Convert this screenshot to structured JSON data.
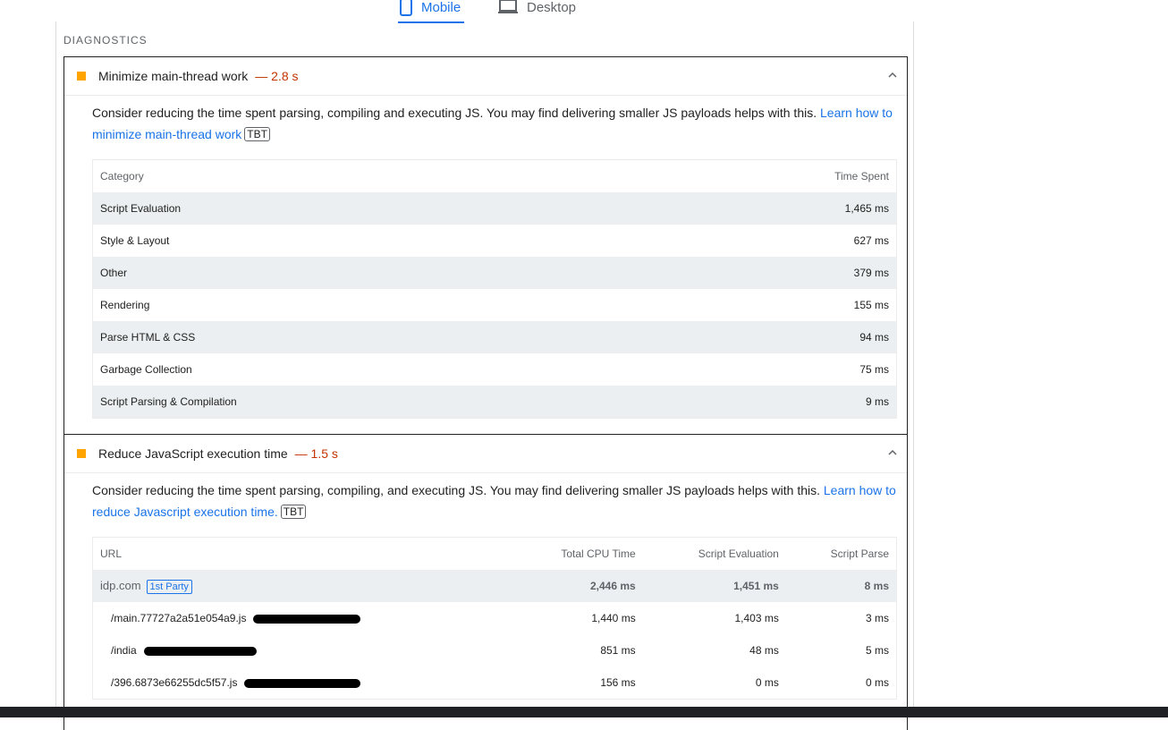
{
  "tabs": {
    "mobile": "Mobile",
    "desktop": "Desktop"
  },
  "section_title": "DIAGNOSTICS",
  "audit1": {
    "title": "Minimize main-thread work",
    "value": "— 2.8 s",
    "desc_text": "Consider reducing the time spent parsing, compiling and executing JS. You may find delivering smaller JS payloads helps with this. ",
    "link_text": "Learn how to minimize main-thread work",
    "tag": "TBT",
    "col_category": "Category",
    "col_time": "Time Spent",
    "rows": [
      {
        "category": "Script Evaluation",
        "time": "1,465 ms"
      },
      {
        "category": "Style & Layout",
        "time": "627 ms"
      },
      {
        "category": "Other",
        "time": "379 ms"
      },
      {
        "category": "Rendering",
        "time": "155 ms"
      },
      {
        "category": "Parse HTML & CSS",
        "time": "94 ms"
      },
      {
        "category": "Garbage Collection",
        "time": "75 ms"
      },
      {
        "category": "Script Parsing & Compilation",
        "time": "9 ms"
      }
    ]
  },
  "audit2": {
    "title": "Reduce JavaScript execution time",
    "value": "— 1.5 s",
    "desc_text": "Consider reducing the time spent parsing, compiling, and executing JS. You may find delivering smaller JS payloads helps with this. ",
    "link_text": "Learn how to reduce Javascript execution time.",
    "tag": "TBT",
    "col_url": "URL",
    "col_cpu": "Total CPU Time",
    "col_eval": "Script Evaluation",
    "col_parse": "Script Parse",
    "group": {
      "url": "idp.com",
      "badge": "1st Party",
      "cpu": "2,446 ms",
      "eval": "1,451 ms",
      "parse": "8 ms"
    },
    "rows": [
      {
        "url": "/main.77727a2a51e054a9.js",
        "cpu": "1,440 ms",
        "eval": "1,403 ms",
        "parse": "3 ms"
      },
      {
        "url": "/india",
        "cpu": "851 ms",
        "eval": "48 ms",
        "parse": "5 ms"
      },
      {
        "url": "/396.6873e66255dc5f57.js",
        "cpu": "156 ms",
        "eval": "0 ms",
        "parse": "0 ms"
      }
    ]
  },
  "colors": {
    "accent": "#1a73e8",
    "warn": "#ffa400",
    "value": "#c33300"
  }
}
